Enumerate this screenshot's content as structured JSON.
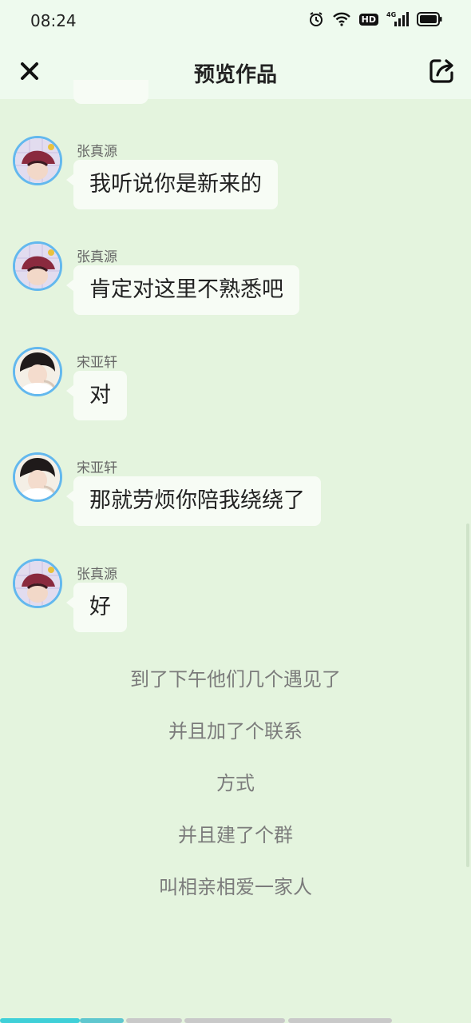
{
  "status_bar": {
    "time": "08:24",
    "hd_label": "HD",
    "network_label": "4G"
  },
  "header": {
    "title": "预览作品",
    "close_icon": "close-icon",
    "share_icon": "share-icon"
  },
  "messages": [
    {
      "sender": "张真源",
      "text": "我听说你是新来的",
      "avatar": "avatar-zhangzhenyuan"
    },
    {
      "sender": "张真源",
      "text": "肯定对这里不熟悉吧",
      "avatar": "avatar-zhangzhenyuan"
    },
    {
      "sender": "宋亚轩",
      "text": "对",
      "avatar": "avatar-songyaxuan"
    },
    {
      "sender": "宋亚轩",
      "text": "那就劳烦你陪我绕绕了",
      "avatar": "avatar-songyaxuan"
    },
    {
      "sender": "张真源",
      "text": "好",
      "avatar": "avatar-zhangzhenyuan"
    }
  ],
  "narration": [
    "到了下午他们几个遇见了",
    "并且加了个联系",
    "方式",
    "并且建了个群",
    "叫相亲相爱一家人"
  ],
  "progress": {
    "filled_fraction": 0.26
  },
  "colors": {
    "background": "#e4f4de",
    "header": "#eefaee",
    "avatar_ring": "#63b8ee",
    "progress_active": "#3fd0d8"
  }
}
